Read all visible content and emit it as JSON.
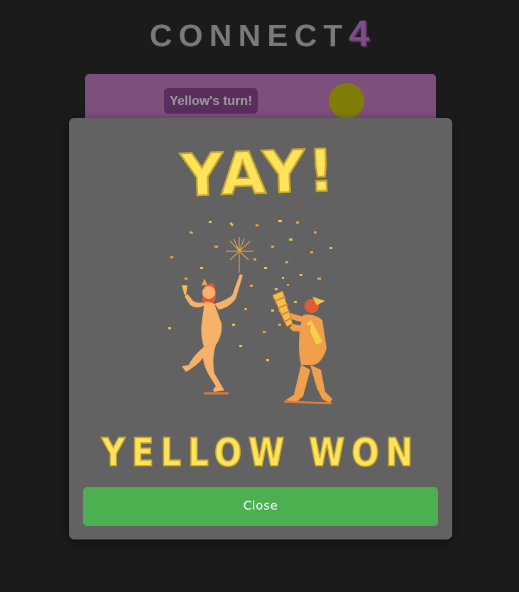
{
  "header": {
    "title": "CONNECT",
    "title_suffix": "4"
  },
  "status": {
    "turn_text": "Yellow's turn!",
    "current_player_color": "#7f7d08"
  },
  "modal": {
    "headline": "YAY!",
    "result_text": "YELLOW WON",
    "close_label": "Close",
    "illustration_icon": "celebrating-couple-illustration"
  },
  "colors": {
    "background": "#1b1b1b",
    "board_header": "#7d4f7c",
    "modal_background": "#626262",
    "lettering": "#ffe35a",
    "close_button": "#4caf50"
  }
}
